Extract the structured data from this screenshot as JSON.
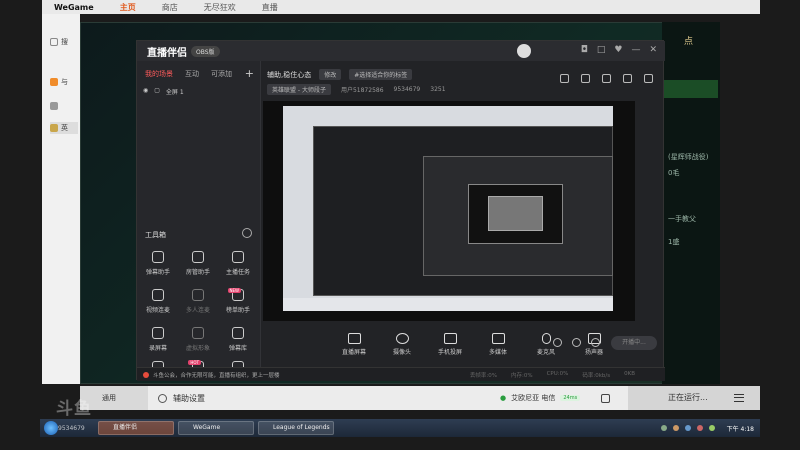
{
  "wegame": {
    "logo": "WeGame",
    "tabs": [
      {
        "label": "主页",
        "active": true
      },
      {
        "label": "商店",
        "active": false
      },
      {
        "label": "无尽狂欢",
        "active": false
      },
      {
        "label": "直播",
        "active": false
      }
    ],
    "side_items": [
      {
        "label": "搜"
      },
      {
        "label": "与"
      },
      {
        "label": "英"
      }
    ]
  },
  "lol": {
    "top_label": "点",
    "side_notes": [
      "(星辉师战役)",
      "0毛",
      "一手教父",
      "1盛"
    ]
  },
  "stream_app": {
    "logo": "直播伴侣",
    "badge": "OBS版",
    "window_buttons": [
      "◘",
      "□",
      "♥",
      "—",
      "✕"
    ],
    "sidebar": {
      "tabs": [
        {
          "label": "我的场景",
          "active": true
        },
        {
          "label": "互动",
          "active": false
        },
        {
          "label": "可添加",
          "active": false
        }
      ],
      "add_label": "+",
      "scene_label": "全屏 1",
      "tools_title": "工具箱",
      "tools": [
        {
          "label": "弹幕助手",
          "tag": ""
        },
        {
          "label": "房管助手",
          "tag": ""
        },
        {
          "label": "主播任务",
          "tag": ""
        },
        {
          "label": "视频连麦",
          "tag": ""
        },
        {
          "label": "多人连麦",
          "tag": "",
          "dim": true
        },
        {
          "label": "榜单助手",
          "tag": "NEW"
        },
        {
          "label": "录屏幕",
          "tag": ""
        },
        {
          "label": "虚拟形象",
          "tag": "",
          "dim": true
        },
        {
          "label": "弹幕库",
          "tag": ""
        },
        {
          "label": "",
          "tag": ""
        },
        {
          "label": "",
          "tag": "HOT"
        },
        {
          "label": "",
          "tag": ""
        }
      ]
    },
    "header": {
      "room_title": "辅助,稳住心态",
      "edit_label": "修改",
      "topic_placeholder": "#选择适合你的标签",
      "category": "英雄联盟 - 大师段子",
      "uid": "用户51872586",
      "room_id": "9534679",
      "fans": "3251"
    },
    "controls": [
      {
        "label": "直播屏幕"
      },
      {
        "label": "摄像头"
      },
      {
        "label": "手机投屏"
      },
      {
        "label": "多媒体"
      },
      {
        "label": "麦克风"
      },
      {
        "label": "扬声器"
      }
    ],
    "start_button": "开播中...",
    "status": {
      "message": "斗鱼公会，合作无限可能，直播有组织，更上一层楼",
      "stats": [
        "丢帧率:0%",
        "内存:0%",
        "CPU:0%",
        "码率:0kb/s",
        "0KB"
      ]
    }
  },
  "helper_bar": {
    "app_label": "通用",
    "settings_label": "辅助设置",
    "game_label": "艾欧尼亚 电信",
    "ping_badge": "24ms",
    "running_label": "正在运行..."
  },
  "taskbar": {
    "items": [
      "直播伴侣",
      "WeGame",
      "League of Legends"
    ],
    "clock": "下午 4:18"
  },
  "watermark": {
    "text": "斗鱼",
    "room_id": "9534679"
  }
}
